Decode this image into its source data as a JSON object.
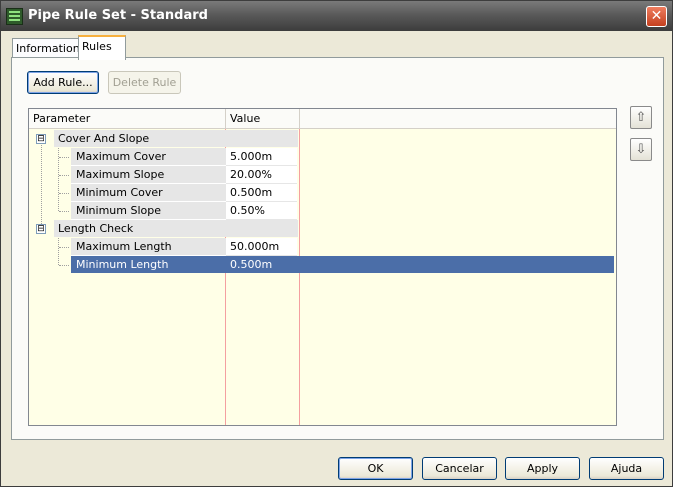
{
  "window": {
    "title": "Pipe Rule Set - Standard",
    "close_icon": "close-icon",
    "app_icon": "pipe-rule-set-icon"
  },
  "tabs": [
    {
      "label": "Information",
      "active": false
    },
    {
      "label": "Rules",
      "active": true
    }
  ],
  "rules_toolbar": {
    "add_rule_label": "Add Rule...",
    "delete_rule_label": "Delete Rule"
  },
  "grid": {
    "columns": [
      "Parameter",
      "Value"
    ],
    "groups": [
      {
        "name": "Cover And Slope",
        "expander": "⊟",
        "rows": [
          {
            "parameter": "Maximum Cover",
            "value": "5.000m"
          },
          {
            "parameter": "Maximum Slope",
            "value": "20.00%"
          },
          {
            "parameter": "Minimum Cover",
            "value": "0.500m"
          },
          {
            "parameter": "Minimum Slope",
            "value": "0.50%"
          }
        ]
      },
      {
        "name": "Length Check",
        "expander": "⊟",
        "rows": [
          {
            "parameter": "Maximum Length",
            "value": "50.000m"
          },
          {
            "parameter": "Minimum Length",
            "value": "0.500m",
            "selected": true
          }
        ]
      }
    ]
  },
  "side_buttons": {
    "move_up_icon": "⇧",
    "move_down_icon": "⇩"
  },
  "footer": {
    "ok_label": "OK",
    "cancel_label": "Cancelar",
    "apply_label": "Apply",
    "help_label": "Ajuda"
  },
  "colors": {
    "selection": "#4b6ea8",
    "grid_background": "#ffffe7",
    "close_button": "#c4401f"
  }
}
